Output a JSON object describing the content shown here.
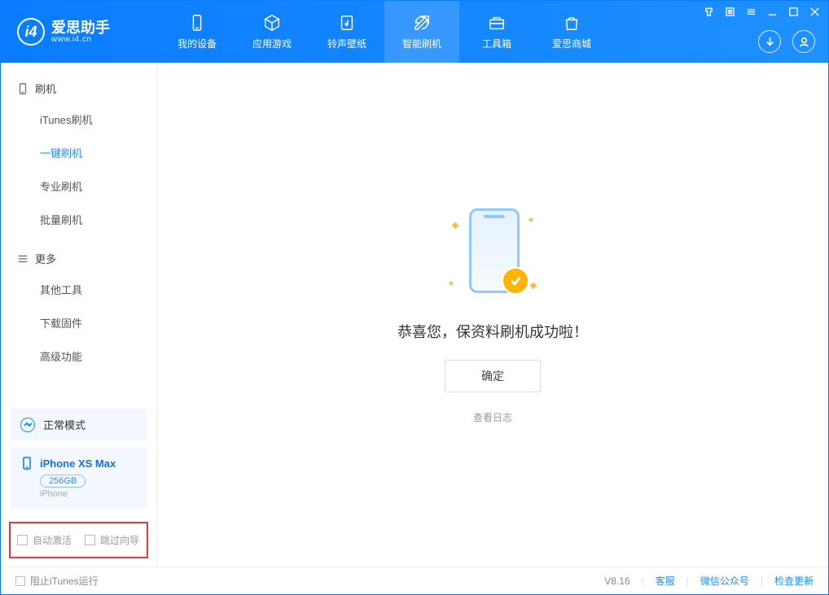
{
  "app": {
    "name_cn": "爱思助手",
    "name_en": "www.i4.cn"
  },
  "nav": {
    "items": [
      {
        "label": "我的设备"
      },
      {
        "label": "应用游戏"
      },
      {
        "label": "铃声壁纸"
      },
      {
        "label": "智能刷机"
      },
      {
        "label": "工具箱"
      },
      {
        "label": "爱思商城"
      }
    ]
  },
  "sidebar": {
    "section1_title": "刷机",
    "section1_items": [
      {
        "label": "iTunes刷机"
      },
      {
        "label": "一键刷机"
      },
      {
        "label": "专业刷机"
      },
      {
        "label": "批量刷机"
      }
    ],
    "section2_title": "更多",
    "section2_items": [
      {
        "label": "其他工具"
      },
      {
        "label": "下载固件"
      },
      {
        "label": "高级功能"
      }
    ],
    "mode_label": "正常模式",
    "device_name": "iPhone XS Max",
    "device_capacity": "256GB",
    "device_type": "iPhone",
    "auto_activate_label": "自动激活",
    "skip_guide_label": "跳过向导"
  },
  "main": {
    "message": "恭喜您，保资料刷机成功啦！",
    "ok_button": "确定",
    "view_log": "查看日志"
  },
  "footer": {
    "block_itunes": "阻止iTunes运行",
    "version": "V8.16",
    "links": [
      "客服",
      "微信公众号",
      "检查更新"
    ]
  }
}
